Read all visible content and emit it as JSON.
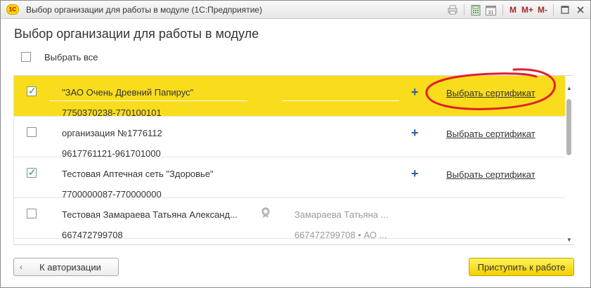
{
  "window": {
    "title": "Выбор организации для работы в модуле  (1С:Предприятие)",
    "logo_text": "1С",
    "toolbar": {
      "m1": "M",
      "m_plus": "M+",
      "m_minus": "M-"
    }
  },
  "page": {
    "title": "Выбор организации для работы в модуле"
  },
  "select_all": {
    "label": "Выбрать все",
    "checked": false
  },
  "organizations": [
    {
      "name": "\"ЗАО Очень Древний Папирус\"",
      "inn": "7750370238-770100101",
      "checked": true,
      "active": true,
      "action": "Выбрать сертификат"
    },
    {
      "name": "организация №1776112",
      "inn": "9617761121-961701000",
      "checked": false,
      "active": false,
      "action": "Выбрать сертификат"
    },
    {
      "name": "Тестовая Аптечная сеть \"Здоровье\"",
      "inn": "7700000087-770000000",
      "checked": true,
      "active": false,
      "action": "Выбрать сертификат"
    },
    {
      "name": "Тестовая Замараева Татьяна Александ...",
      "inn": "667472799708",
      "checked": false,
      "active": false,
      "owner": "Замараева Татьяна ...",
      "owner_inn": "667472799708 • АО ..."
    }
  ],
  "icons": {
    "add": "plus-icon",
    "certificate": "seal-icon",
    "check": "checkmark-icon"
  },
  "colors": {
    "highlight": "#f9dc1c",
    "annotation": "#e0202a",
    "primary_button": "#f6d600"
  },
  "buttons": {
    "back": "К авторизации",
    "start": "Приступить к работе"
  }
}
